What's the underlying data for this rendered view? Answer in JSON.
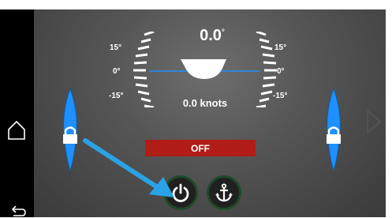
{
  "heading": {
    "angle": "0.0",
    "angle_unit": "°",
    "scale_left": [
      "15°",
      "0°",
      "-15°"
    ],
    "scale_right": [
      "15°",
      "0°",
      "-15°"
    ]
  },
  "speed": "0.0 knots",
  "status": "OFF",
  "nav": {
    "home_icon": "home-icon",
    "back_icon": "back-icon",
    "next_icon": "chevron-right-icon"
  },
  "controls": {
    "power_icon": "power-icon",
    "anchor_icon": "anchor-icon"
  },
  "trim_tabs": {
    "left_icon": "lock-icon",
    "right_icon": "lock-icon"
  },
  "colors": {
    "accent_blue": "#1e90ff",
    "status_red": "#b11c17",
    "button_ring": "#1d4a2a",
    "annotation_arrow": "#2aa3e6"
  }
}
